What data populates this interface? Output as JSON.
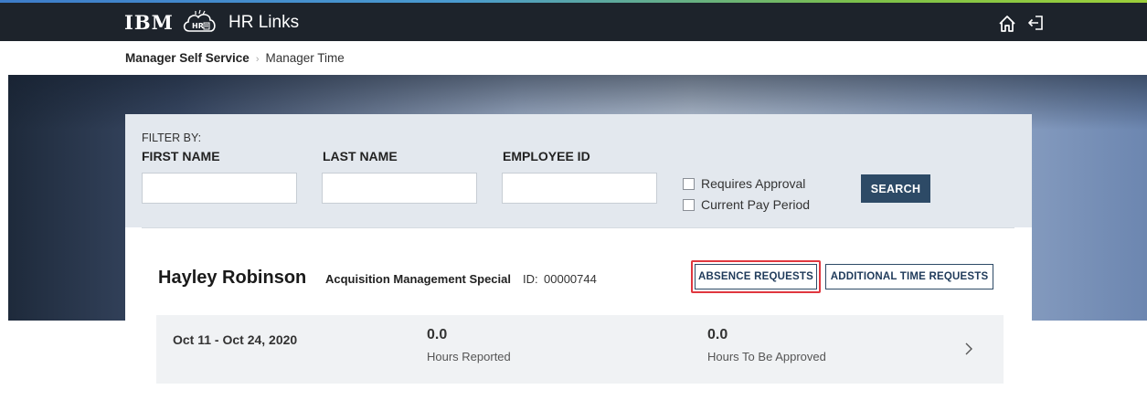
{
  "header": {
    "logo_text": "IBM",
    "app_icon": "hr-cloud-icon",
    "app_title": "HR Links",
    "home_icon": "home-icon",
    "logout_icon": "logout-icon"
  },
  "breadcrumb": {
    "items": [
      "Manager Self Service",
      "Manager Time"
    ]
  },
  "filter": {
    "title": "FILTER BY:",
    "first_name_label": "FIRST NAME",
    "first_name_value": "",
    "last_name_label": "LAST NAME",
    "last_name_value": "",
    "employee_id_label": "EMPLOYEE ID",
    "employee_id_value": "",
    "requires_approval_label": "Requires Approval",
    "requires_approval_checked": false,
    "current_pay_period_label": "Current Pay Period",
    "current_pay_period_checked": false,
    "search_label": "SEARCH"
  },
  "employee": {
    "name": "Hayley Robinson",
    "department": "Acquisition Management Special",
    "id_label": "ID:",
    "id_value": "00000744",
    "absence_btn": "ABSENCE REQUESTS",
    "additional_btn": "ADDITIONAL TIME REQUESTS",
    "period": {
      "range": "Oct 11 - Oct 24, 2020",
      "hours_reported_value": "0.0",
      "hours_reported_label": "Hours Reported",
      "hours_to_approve_value": "0.0",
      "hours_to_approve_label": "Hours To Be Approved"
    }
  },
  "colors": {
    "topbar": "#1d232b",
    "primary_button": "#2d4a66",
    "highlight": "#e0373f",
    "filter_panel": "#e3e8ee"
  }
}
